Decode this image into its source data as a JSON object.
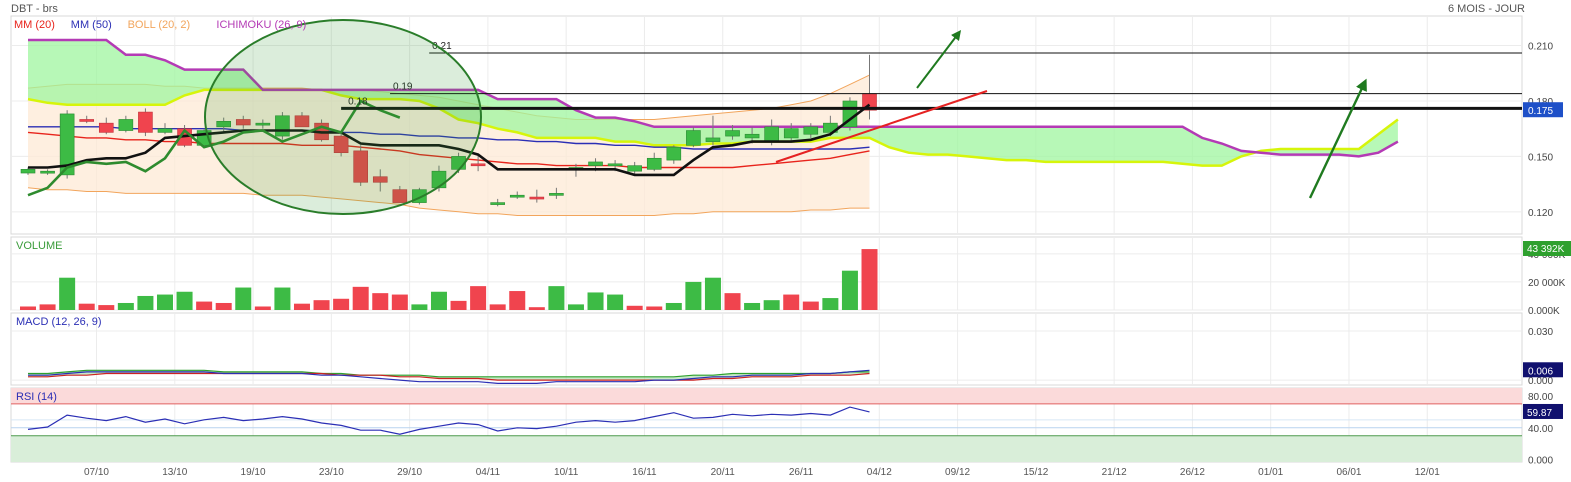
{
  "header": {
    "symbol": "DBT - brs",
    "period": "6 MOIS - JOUR"
  },
  "colors": {
    "up": "#3dbb45",
    "down": "#f0444e",
    "mm20": "#e8241c",
    "mm50": "#2b2fb5",
    "boll": "#f2a55c",
    "ichimoku": "#b43ab5",
    "cloud": "#9ff59f",
    "cloud_edge": "#d6f50a",
    "black_line": "#111111",
    "green_line": "#2e8b2e",
    "annotation": "#1f7a1f",
    "rsi_band_top": "#fbdada",
    "rsi_band_bottom": "#d9eed9",
    "price_tag": "#1e50c8"
  },
  "legend": {
    "mm20": "MM (20)",
    "mm50": "MM (50)",
    "boll": "BOLL (20, 2)",
    "ichimoku": "ICHIMOKU (26, 9)"
  },
  "chart_data": [
    {
      "type": "candlestick",
      "pane": "price",
      "x_labels": [
        "07/10",
        "13/10",
        "19/10",
        "23/10",
        "29/10",
        "04/11",
        "10/11",
        "16/11",
        "20/11",
        "26/11",
        "04/12",
        "09/12",
        "15/12",
        "21/12",
        "26/12",
        "01/01",
        "06/01",
        "12/01"
      ],
      "x_label_index": [
        3.5,
        7.5,
        11.5,
        15.5,
        19.5,
        23.5,
        27.5,
        31.5,
        35.5,
        39.5,
        43.5,
        47.5,
        51.5,
        55.5,
        59.5,
        63.5,
        67.5,
        71.5
      ],
      "y_ticks": [
        "0.210",
        "0.180",
        "0.150",
        "0.120"
      ],
      "y_tick_values": [
        0.21,
        0.18,
        0.15,
        0.12
      ],
      "ylim": [
        0.108,
        0.226
      ],
      "last_price": "0.175",
      "candles": [
        {
          "o": 0.141,
          "h": 0.144,
          "l": 0.14,
          "c": 0.143
        },
        {
          "o": 0.141,
          "h": 0.143,
          "l": 0.14,
          "c": 0.142
        },
        {
          "o": 0.14,
          "h": 0.175,
          "l": 0.138,
          "c": 0.173
        },
        {
          "o": 0.17,
          "h": 0.172,
          "l": 0.168,
          "c": 0.169
        },
        {
          "o": 0.168,
          "h": 0.171,
          "l": 0.162,
          "c": 0.163
        },
        {
          "o": 0.164,
          "h": 0.172,
          "l": 0.163,
          "c": 0.17
        },
        {
          "o": 0.174,
          "h": 0.176,
          "l": 0.161,
          "c": 0.163
        },
        {
          "o": 0.163,
          "h": 0.168,
          "l": 0.162,
          "c": 0.165
        },
        {
          "o": 0.165,
          "h": 0.167,
          "l": 0.155,
          "c": 0.156
        },
        {
          "o": 0.156,
          "h": 0.165,
          "l": 0.155,
          "c": 0.164
        },
        {
          "o": 0.166,
          "h": 0.171,
          "l": 0.163,
          "c": 0.169
        },
        {
          "o": 0.17,
          "h": 0.172,
          "l": 0.165,
          "c": 0.167
        },
        {
          "o": 0.167,
          "h": 0.17,
          "l": 0.165,
          "c": 0.168
        },
        {
          "o": 0.161,
          "h": 0.174,
          "l": 0.159,
          "c": 0.172
        },
        {
          "o": 0.172,
          "h": 0.174,
          "l": 0.166,
          "c": 0.166
        },
        {
          "o": 0.168,
          "h": 0.17,
          "l": 0.158,
          "c": 0.159
        },
        {
          "o": 0.161,
          "h": 0.163,
          "l": 0.15,
          "c": 0.152
        },
        {
          "o": 0.153,
          "h": 0.156,
          "l": 0.134,
          "c": 0.136
        },
        {
          "o": 0.139,
          "h": 0.143,
          "l": 0.131,
          "c": 0.136
        },
        {
          "o": 0.132,
          "h": 0.134,
          "l": 0.125,
          "c": 0.125
        },
        {
          "o": 0.125,
          "h": 0.133,
          "l": 0.124,
          "c": 0.132
        },
        {
          "o": 0.133,
          "h": 0.145,
          "l": 0.131,
          "c": 0.142
        },
        {
          "o": 0.143,
          "h": 0.152,
          "l": 0.141,
          "c": 0.15
        },
        {
          "o": 0.146,
          "h": 0.151,
          "l": 0.142,
          "c": 0.145
        },
        {
          "o": 0.125,
          "h": 0.127,
          "l": 0.123,
          "c": 0.125
        },
        {
          "o": 0.129,
          "h": 0.131,
          "l": 0.127,
          "c": 0.129
        },
        {
          "o": 0.128,
          "h": 0.132,
          "l": 0.125,
          "c": 0.127
        },
        {
          "o": 0.129,
          "h": 0.133,
          "l": 0.127,
          "c": 0.13
        },
        {
          "o": 0.143,
          "h": 0.146,
          "l": 0.139,
          "c": 0.144
        },
        {
          "o": 0.145,
          "h": 0.149,
          "l": 0.142,
          "c": 0.147
        },
        {
          "o": 0.145,
          "h": 0.148,
          "l": 0.142,
          "c": 0.146
        },
        {
          "o": 0.142,
          "h": 0.147,
          "l": 0.14,
          "c": 0.145
        },
        {
          "o": 0.143,
          "h": 0.152,
          "l": 0.142,
          "c": 0.149
        },
        {
          "o": 0.148,
          "h": 0.156,
          "l": 0.146,
          "c": 0.155
        },
        {
          "o": 0.156,
          "h": 0.166,
          "l": 0.155,
          "c": 0.164
        },
        {
          "o": 0.158,
          "h": 0.172,
          "l": 0.156,
          "c": 0.16
        },
        {
          "o": 0.161,
          "h": 0.167,
          "l": 0.159,
          "c": 0.164
        },
        {
          "o": 0.16,
          "h": 0.166,
          "l": 0.157,
          "c": 0.162
        },
        {
          "o": 0.158,
          "h": 0.17,
          "l": 0.156,
          "c": 0.166
        },
        {
          "o": 0.16,
          "h": 0.168,
          "l": 0.158,
          "c": 0.165
        },
        {
          "o": 0.162,
          "h": 0.168,
          "l": 0.16,
          "c": 0.166
        },
        {
          "o": 0.163,
          "h": 0.172,
          "l": 0.161,
          "c": 0.168
        },
        {
          "o": 0.166,
          "h": 0.182,
          "l": 0.164,
          "c": 0.18
        },
        {
          "o": 0.184,
          "h": 0.205,
          "l": 0.17,
          "c": 0.175
        }
      ],
      "mm20": [
        0.163,
        0.162,
        0.161,
        0.16,
        0.16,
        0.159,
        0.159,
        0.158,
        0.158,
        0.157,
        0.157,
        0.157,
        0.157,
        0.157,
        0.156,
        0.156,
        0.156,
        0.155,
        0.154,
        0.153,
        0.151,
        0.15,
        0.149,
        0.148,
        0.147,
        0.146,
        0.146,
        0.145,
        0.145,
        0.145,
        0.145,
        0.144,
        0.144,
        0.144,
        0.144,
        0.144,
        0.144,
        0.145,
        0.146,
        0.147,
        0.148,
        0.149,
        0.151,
        0.153
      ],
      "mm50": [
        0.166,
        0.166,
        0.166,
        0.166,
        0.166,
        0.165,
        0.165,
        0.165,
        0.165,
        0.165,
        0.165,
        0.164,
        0.164,
        0.164,
        0.164,
        0.164,
        0.163,
        0.163,
        0.162,
        0.162,
        0.161,
        0.161,
        0.16,
        0.16,
        0.159,
        0.159,
        0.158,
        0.158,
        0.157,
        0.157,
        0.156,
        0.156,
        0.155,
        0.155,
        0.154,
        0.154,
        0.154,
        0.154,
        0.154,
        0.154,
        0.154,
        0.154,
        0.154,
        0.155
      ],
      "boll_upper": [
        0.187,
        0.188,
        0.189,
        0.189,
        0.189,
        0.189,
        0.189,
        0.188,
        0.188,
        0.187,
        0.187,
        0.187,
        0.187,
        0.187,
        0.187,
        0.186,
        0.186,
        0.186,
        0.185,
        0.184,
        0.183,
        0.182,
        0.18,
        0.178,
        0.176,
        0.174,
        0.172,
        0.171,
        0.17,
        0.17,
        0.17,
        0.17,
        0.17,
        0.171,
        0.172,
        0.173,
        0.174,
        0.175,
        0.176,
        0.178,
        0.18,
        0.184,
        0.189,
        0.194
      ],
      "boll_lower": [
        0.133,
        0.132,
        0.132,
        0.131,
        0.131,
        0.13,
        0.13,
        0.13,
        0.13,
        0.13,
        0.13,
        0.13,
        0.129,
        0.129,
        0.129,
        0.128,
        0.127,
        0.126,
        0.125,
        0.124,
        0.122,
        0.121,
        0.12,
        0.119,
        0.119,
        0.118,
        0.118,
        0.118,
        0.118,
        0.118,
        0.118,
        0.118,
        0.118,
        0.119,
        0.119,
        0.12,
        0.12,
        0.12,
        0.12,
        0.12,
        0.121,
        0.121,
        0.122,
        0.122
      ],
      "black_line": [
        0.144,
        0.144,
        0.145,
        0.148,
        0.149,
        0.149,
        0.152,
        0.16,
        0.161,
        0.162,
        0.163,
        0.164,
        0.164,
        0.164,
        0.164,
        0.163,
        0.163,
        0.157,
        0.156,
        0.156,
        0.156,
        0.156,
        0.154,
        0.151,
        0.143,
        0.143,
        0.143,
        0.143,
        0.143,
        0.143,
        0.143,
        0.14,
        0.14,
        0.14,
        0.148,
        0.155,
        0.156,
        0.158,
        0.158,
        0.158,
        0.159,
        0.162,
        0.17,
        0.178
      ],
      "green_line": [
        0.129,
        0.133,
        0.144,
        0.147,
        0.146,
        0.147,
        0.142,
        0.149,
        0.164,
        0.155,
        0.158,
        0.163,
        0.164,
        0.158,
        0.162,
        0.166,
        0.163,
        0.18,
        0.175,
        0.171
      ],
      "green_line_start": 0,
      "ichimoku_upper": [
        0.213,
        0.213,
        0.213,
        0.213,
        0.213,
        0.205,
        0.205,
        0.202,
        0.197,
        0.197,
        0.197,
        0.197,
        0.186,
        0.186,
        0.186,
        0.186,
        0.186,
        0.186,
        0.186,
        0.186,
        0.186,
        0.186,
        0.186,
        0.186,
        0.181,
        0.181,
        0.181,
        0.181,
        0.175,
        0.171,
        0.171,
        0.169,
        0.166,
        0.166,
        0.166,
        0.166,
        0.166,
        0.166,
        0.166,
        0.166,
        0.166,
        0.166,
        0.166,
        0.166,
        0.166,
        0.166,
        0.166,
        0.166,
        0.166,
        0.166,
        0.166,
        0.166,
        0.166,
        0.166,
        0.166,
        0.166,
        0.166,
        0.166,
        0.166,
        0.166,
        0.16,
        0.157,
        0.153,
        0.152,
        0.151,
        0.151,
        0.151,
        0.151,
        0.15,
        0.152,
        0.158
      ],
      "ichimoku_lower": [
        0.181,
        0.179,
        0.178,
        0.178,
        0.178,
        0.178,
        0.178,
        0.178,
        0.183,
        0.186,
        0.186,
        0.186,
        0.186,
        0.186,
        0.186,
        0.186,
        0.183,
        0.181,
        0.181,
        0.181,
        0.18,
        0.176,
        0.17,
        0.168,
        0.165,
        0.163,
        0.16,
        0.16,
        0.16,
        0.16,
        0.158,
        0.158,
        0.156,
        0.156,
        0.156,
        0.157,
        0.157,
        0.158,
        0.158,
        0.158,
        0.158,
        0.16,
        0.16,
        0.16,
        0.155,
        0.152,
        0.151,
        0.151,
        0.15,
        0.149,
        0.148,
        0.148,
        0.147,
        0.147,
        0.147,
        0.147,
        0.147,
        0.147,
        0.147,
        0.146,
        0.145,
        0.145,
        0.15,
        0.153,
        0.154,
        0.154,
        0.154,
        0.154,
        0.154,
        0.162,
        0.17
      ],
      "ichimoku_start": 0,
      "annotations": {
        "levels": [
          {
            "label": "0.21",
            "value": 0.206,
            "from": 20.5
          },
          {
            "label": "0.19",
            "value": 0.184,
            "from": 18.5
          },
          {
            "label": "0.18",
            "value": 0.176,
            "from": 16,
            "bold": true
          }
        ]
      }
    },
    {
      "type": "bar",
      "pane": "volume",
      "title": "VOLUME",
      "y_ticks": [
        "40 000K",
        "20 000K",
        "0.000K"
      ],
      "y_tick_values": [
        40000,
        20000,
        0
      ],
      "ylim": [
        0,
        52000
      ],
      "last_value": "43 392K",
      "values": [
        2500,
        4000,
        23000,
        4500,
        3500,
        5000,
        10000,
        11000,
        13000,
        6000,
        5000,
        16000,
        2500,
        16000,
        4500,
        7000,
        8000,
        16500,
        12000,
        11000,
        4000,
        13000,
        6500,
        17000,
        4000,
        13500,
        2000,
        17000,
        4000,
        12500,
        11000,
        3000,
        2500,
        5000,
        20000,
        23000,
        12000,
        5000,
        7000,
        11000,
        6000,
        8500,
        28000,
        43392
      ],
      "directions": [
        "down",
        "down",
        "up",
        "down",
        "down",
        "up",
        "up",
        "up",
        "up",
        "down",
        "down",
        "up",
        "down",
        "up",
        "down",
        "down",
        "down",
        "down",
        "down",
        "down",
        "up",
        "up",
        "down",
        "down",
        "down",
        "down",
        "down",
        "up",
        "up",
        "up",
        "up",
        "down",
        "down",
        "up",
        "up",
        "up",
        "down",
        "up",
        "up",
        "down",
        "down",
        "up",
        "up",
        "down"
      ]
    },
    {
      "type": "line",
      "pane": "macd",
      "title": "MACD (12, 26, 9)",
      "y_ticks": [
        "0.030",
        "0.000"
      ],
      "y_tick_values": [
        0.03,
        0.0
      ],
      "ylim": [
        -0.003,
        0.041
      ],
      "last_value": "0.006",
      "series": [
        {
          "name": "macd",
          "values": [
            0.003,
            0.003,
            0.004,
            0.005,
            0.005,
            0.005,
            0.005,
            0.005,
            0.005,
            0.005,
            0.004,
            0.004,
            0.004,
            0.004,
            0.004,
            0.003,
            0.003,
            0.002,
            0.001,
            0.0,
            -0.001,
            -0.001,
            -0.001,
            -0.001,
            -0.002,
            -0.002,
            -0.002,
            -0.001,
            -0.001,
            -0.001,
            -0.001,
            -0.001,
            0.0,
            0.0,
            0.001,
            0.002,
            0.002,
            0.003,
            0.003,
            0.003,
            0.004,
            0.004,
            0.005,
            0.006
          ]
        },
        {
          "name": "signal",
          "values": [
            0.002,
            0.002,
            0.003,
            0.003,
            0.004,
            0.004,
            0.004,
            0.004,
            0.004,
            0.004,
            0.004,
            0.004,
            0.004,
            0.004,
            0.004,
            0.004,
            0.003,
            0.003,
            0.003,
            0.002,
            0.002,
            0.001,
            0.001,
            0.001,
            0.0,
            0.0,
            0.0,
            0.0,
            0.0,
            0.0,
            0.0,
            0.0,
            0.0,
            0.0,
            0.0,
            0.001,
            0.001,
            0.002,
            0.002,
            0.002,
            0.003,
            0.003,
            0.003,
            0.004
          ]
        },
        {
          "name": "histogram_upper",
          "values": [
            0.004,
            0.004,
            0.005,
            0.006,
            0.006,
            0.006,
            0.006,
            0.006,
            0.006,
            0.006,
            0.005,
            0.005,
            0.005,
            0.005,
            0.005,
            0.004,
            0.004,
            0.003,
            0.003,
            0.003,
            0.003,
            0.002,
            0.002,
            0.002,
            0.002,
            0.002,
            0.002,
            0.002,
            0.002,
            0.002,
            0.002,
            0.002,
            0.002,
            0.002,
            0.003,
            0.003,
            0.004,
            0.004,
            0.004,
            0.004,
            0.004,
            0.004,
            0.005,
            0.005
          ]
        }
      ]
    },
    {
      "type": "line",
      "pane": "rsi",
      "title": "RSI (14)",
      "y_ticks": [
        "80.00",
        "40.00",
        "0.000"
      ],
      "y_tick_values": [
        80,
        40,
        0
      ],
      "ylim": [
        -3,
        90
      ],
      "bands": {
        "overbought": 70,
        "oversold": 30
      },
      "last_value": "59.87",
      "values": [
        38,
        41,
        56,
        52,
        49,
        54,
        47,
        51,
        45,
        50,
        53,
        49,
        51,
        54,
        51,
        46,
        43,
        37,
        37,
        32,
        38,
        42,
        46,
        44,
        36,
        40,
        39,
        42,
        47,
        49,
        47,
        49,
        54,
        59,
        52,
        53,
        57,
        55,
        57,
        56,
        58,
        56,
        66,
        60
      ]
    }
  ]
}
